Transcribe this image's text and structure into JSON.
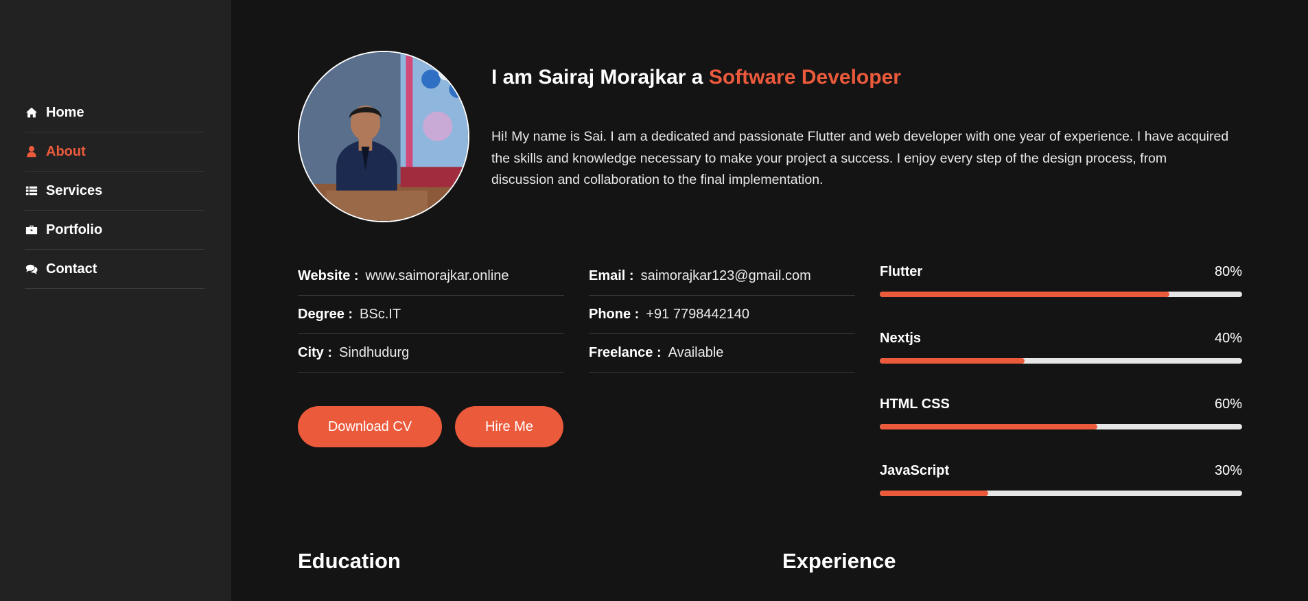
{
  "nav": [
    {
      "label": "Home",
      "icon": "home-icon",
      "active": false
    },
    {
      "label": "About",
      "icon": "user-icon",
      "active": true
    },
    {
      "label": "Services",
      "icon": "list-icon",
      "active": false
    },
    {
      "label": "Portfolio",
      "icon": "briefcase-icon",
      "active": false
    },
    {
      "label": "Contact",
      "icon": "comments-icon",
      "active": false
    }
  ],
  "intro": {
    "title_prefix": "I am Sairaj Morajkar a ",
    "title_accent": "Software Developer",
    "text": "Hi! My name is Sai. I am a dedicated and passionate Flutter and web developer with one year of experience. I have acquired the skills and knowledge necessary to make your project a success. I enjoy every step of the design process, from discussion and collaboration to the final implementation."
  },
  "info_left": [
    {
      "label": "Website :",
      "value": "www.saimorajkar.online"
    },
    {
      "label": "Degree :",
      "value": "BSc.IT"
    },
    {
      "label": "City :",
      "value": "Sindhudurg"
    }
  ],
  "info_right": [
    {
      "label": "Email :",
      "value": "saimorajkar123@gmail.com"
    },
    {
      "label": "Phone :",
      "value": "+91 7798442140"
    },
    {
      "label": "Freelance :",
      "value": "Available"
    }
  ],
  "buttons": {
    "download_cv": "Download CV",
    "hire_me": "Hire Me"
  },
  "skills": [
    {
      "name": "Flutter",
      "percent_label": "80%",
      "level": 0.8
    },
    {
      "name": "Nextjs",
      "percent_label": "40%",
      "level": 0.4
    },
    {
      "name": "HTML CSS",
      "percent_label": "60%",
      "level": 0.6
    },
    {
      "name": "JavaScript",
      "percent_label": "30%",
      "level": 0.3
    }
  ],
  "sections": {
    "education": "Education",
    "experience": "Experience"
  },
  "colors": {
    "accent": "#ec5a3c",
    "background": "#141414",
    "sidebar": "#222222"
  }
}
